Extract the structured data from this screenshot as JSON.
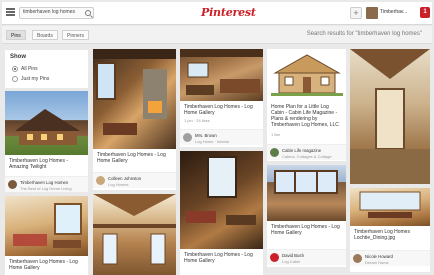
{
  "header": {
    "search_value": "timberhaven log homes",
    "logo": "Pinterest",
    "user_name": "Timberhav...",
    "notifications": "1"
  },
  "subbar": {
    "tabs": [
      {
        "label": "Pins",
        "active": true
      },
      {
        "label": "Boards",
        "active": false
      },
      {
        "label": "Pinners",
        "active": false
      }
    ],
    "results_text": "Search results for \"timberhaven log homes\""
  },
  "sidebar": {
    "title": "Show",
    "options": [
      {
        "label": "All Pins",
        "selected": true
      },
      {
        "label": "Just my Pins",
        "selected": false
      }
    ]
  },
  "pins": [
    {
      "desc": "Timberhaven Log Homes - Amazing Twilight",
      "user": "Timberhaven Log Homes",
      "board": "The Best of Log Home Living"
    },
    {
      "desc": "Timberhaven Log Homes - Log Home Gallery",
      "user": "Colleen Johnston",
      "board": "Log Homes"
    },
    {
      "desc": "Timberhaven Log Homes - Log Home Gallery",
      "meta": "1 pin · 24 likes",
      "user": "Mrs. Brown",
      "board": "Log Home · Interior"
    },
    {
      "desc": "Home Plan for a Little Log Cabin - Cabin Life Magazine - Plans & rendering by Timberhaven Log Homes, LLC",
      "meta": "1 like",
      "user": "Cabin Life magazine",
      "board": "Cabins, Cottages & Cottage"
    },
    {
      "desc": "Timberhaven Log Homes - Log Home Gallery"
    },
    {
      "desc": "Timberhaven Log Homes - Log Home Gallery",
      "user": "David Bush",
      "board": "Log Cabin"
    },
    {
      "desc": "Timberhaven Log Homes Lochtie_Dining.jpg",
      "user": "Nicole Howard",
      "board": "Dream Home"
    }
  ]
}
